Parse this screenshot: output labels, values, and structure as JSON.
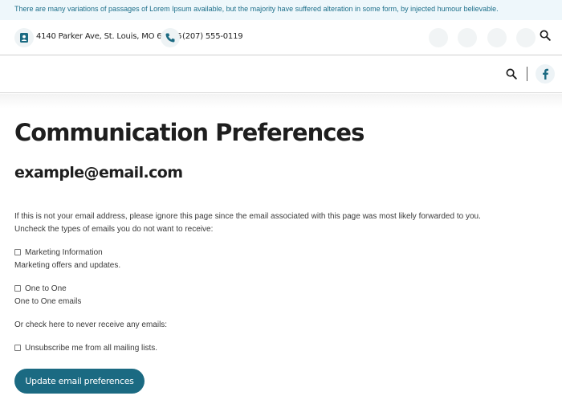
{
  "announcement": "There are many variations of passages of Lorem Ipsum available, but the majority have suffered alteration in some form, by injected humour believable.",
  "contact": {
    "address": "4140 Parker Ave, St. Louis, MO 63116",
    "phone": "(207) 555-0119",
    "icon_color": "#1b6a82"
  },
  "page": {
    "title": "Communication Preferences",
    "email": "example@email.com",
    "intro_line1": "If this is not your email address, please ignore this page since the email associated with this page was most likely forwarded to you.",
    "intro_line2": "Uncheck the types of emails you do not want to receive:",
    "options": [
      {
        "label": "Marketing Information",
        "description": "Marketing offers and updates.",
        "checked": false
      },
      {
        "label": "One to One",
        "description": "One to One emails",
        "checked": false
      }
    ],
    "never_text": "Or check here to never receive any emails:",
    "unsubscribe_label": "Unsubscribe me from all mailing lists.",
    "unsubscribe_checked": false,
    "submit_label": "Update email preferences"
  },
  "colors": {
    "brand": "#1b6a82",
    "announcement_bg": "#eef7fb",
    "announcement_text": "#1d6f8a"
  }
}
